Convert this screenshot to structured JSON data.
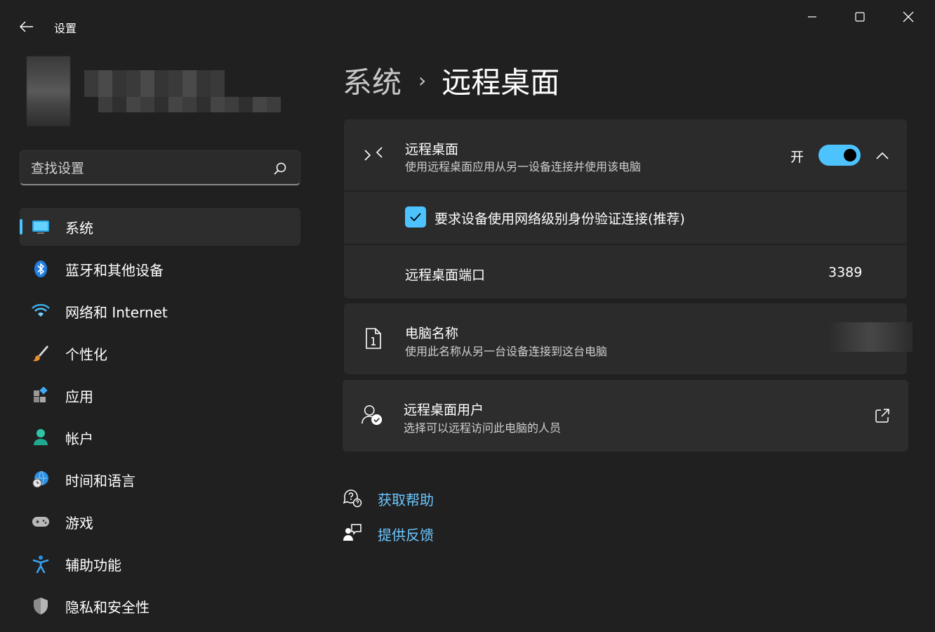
{
  "app": {
    "title": "设置"
  },
  "search": {
    "placeholder": "查找设置"
  },
  "nav": {
    "items": [
      {
        "label": "系统",
        "active": true
      },
      {
        "label": "蓝牙和其他设备"
      },
      {
        "label": "网络和 Internet"
      },
      {
        "label": "个性化"
      },
      {
        "label": "应用"
      },
      {
        "label": "帐户"
      },
      {
        "label": "时间和语言"
      },
      {
        "label": "游戏"
      },
      {
        "label": "辅助功能"
      },
      {
        "label": "隐私和安全性"
      }
    ]
  },
  "breadcrumb": {
    "parent": "系统",
    "separator": "›",
    "current": "远程桌面"
  },
  "remote_desktop": {
    "title": "远程桌面",
    "subtitle": "使用远程桌面应用从另一设备连接并使用该电脑",
    "toggle_label": "开",
    "toggle_on": true,
    "nla_label": "要求设备使用网络级别身份验证连接(推荐)",
    "nla_checked": true,
    "port_label": "远程桌面端口",
    "port_value": "3389"
  },
  "pc_name": {
    "title": "电脑名称",
    "subtitle": "使用此名称从另一台设备连接到这台电脑"
  },
  "rd_users": {
    "title": "远程桌面用户",
    "subtitle": "选择可以远程访问此电脑的人员"
  },
  "links": {
    "help": "获取帮助",
    "feedback": "提供反馈"
  },
  "colors": {
    "accent": "#4cc2ff",
    "link": "#6cc6ff",
    "background": "#202020",
    "card": "#2b2b2b"
  }
}
